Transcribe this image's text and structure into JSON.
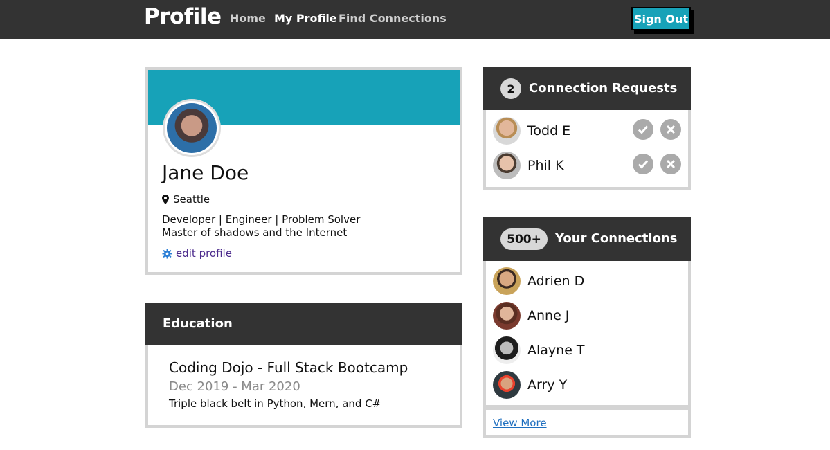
{
  "nav": {
    "brand": "Profile",
    "links": [
      "Home",
      "My Profile",
      "Find Connections"
    ],
    "active": "My Profile",
    "signout": "Sign Out"
  },
  "profile": {
    "name": "Jane Doe",
    "location": "Seattle",
    "bio_lines": [
      "Developer | Engineer | Problem Solver",
      "Master of shadows and the Internet"
    ],
    "edit_label": "edit profile",
    "banner_color": "#17a2b8"
  },
  "education": {
    "header": "Education",
    "title": "Coding Dojo - Full Stack Bootcamp",
    "dates": "Dec 2019 - Mar 2020",
    "description": "Triple black belt in Python, Mern, and C#"
  },
  "requests": {
    "count": "2",
    "header": "Connection Requests",
    "people": [
      "Todd E",
      "Phil K"
    ]
  },
  "connections": {
    "count": "500+",
    "header": "Your Connections",
    "people": [
      "Adrien D",
      "Anne J",
      "Alayne T",
      "Arry Y"
    ],
    "view_more": "View More"
  },
  "colors": {
    "accent": "#17a2b8",
    "dark": "#333333",
    "border": "#d4d4d4"
  },
  "icons": {
    "location": "map-pin-icon",
    "edit": "gear-icon",
    "accept": "check-circle-icon",
    "decline": "x-circle-icon"
  }
}
